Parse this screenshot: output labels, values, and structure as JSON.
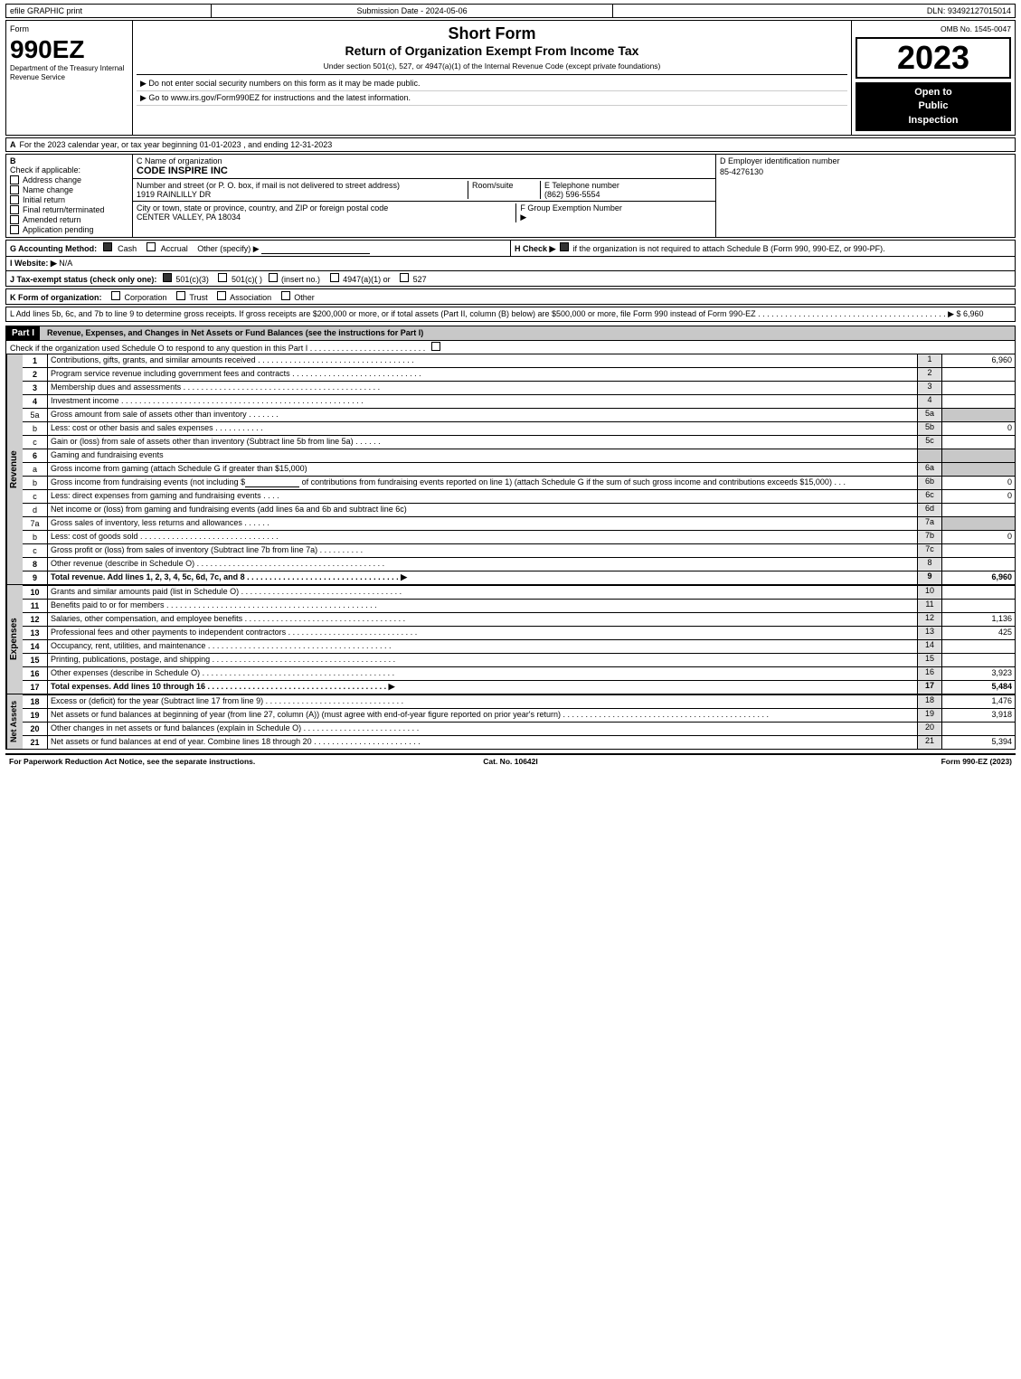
{
  "topBar": {
    "left": "efile GRAPHIC print",
    "mid": "Submission Date - 2024-05-06",
    "right": "DLN: 93492127015014"
  },
  "formNumber": "990EZ",
  "formDept": "Department of the Treasury Internal Revenue Service",
  "titles": {
    "main": "Short Form",
    "sub": "Return of Organization Exempt From Income Tax",
    "under": "Under section 501(c), 527, or 4947(a)(1) of the Internal Revenue Code (except private foundations)"
  },
  "notices": {
    "social": "▶ Do not enter social security numbers on this form as it may be made public.",
    "goto": "▶ Go to www.irs.gov/Form990EZ for instructions and the latest information."
  },
  "omb": "OMB No. 1545-0047",
  "year": "2023",
  "openToPublic": "Open to\nPublic\nInspection",
  "sectionA": {
    "label": "A",
    "text": "For the 2023 calendar year, or tax year beginning 01-01-2023 , and ending 12-31-2023"
  },
  "sectionB": {
    "label": "B",
    "checkLabel": "Check if applicable:",
    "checks": [
      {
        "label": "Address change",
        "checked": false
      },
      {
        "label": "Name change",
        "checked": false
      },
      {
        "label": "Initial return",
        "checked": false
      },
      {
        "label": "Final return/terminated",
        "checked": false
      },
      {
        "label": "Amended return",
        "checked": false
      },
      {
        "label": "Application pending",
        "checked": false
      }
    ]
  },
  "orgName": {
    "label": "C Name of organization",
    "value": "CODE INSPIRE INC"
  },
  "employerId": {
    "label": "D Employer identification number",
    "value": "85-4276130"
  },
  "address": {
    "label": "Number and street (or P. O. box, if mail is not delivered to street address)",
    "value": "1919 RAINLILLY DR",
    "roomLabel": "Room/suite",
    "roomValue": "",
    "eLabel": "E Telephone number",
    "eValue": "(862) 596-5554"
  },
  "cityState": {
    "label": "City or town, state or province, country, and ZIP or foreign postal code",
    "value": "CENTER VALLEY, PA  18034",
    "fLabel": "F Group Exemption Number",
    "fArrow": "▶"
  },
  "accounting": {
    "label": "G Accounting Method:",
    "cashChecked": true,
    "accrualChecked": false,
    "otherText": "Other (specify) ▶"
  },
  "hCheck": {
    "label": "H Check ▶",
    "checked": true,
    "text": "if the organization is not required to attach Schedule B (Form 990, 990-EZ, or 990-PF)."
  },
  "website": {
    "label": "I Website: ▶",
    "value": "N/A"
  },
  "taxExempt": {
    "label": "J Tax-exempt status (check only one):",
    "options": [
      {
        "label": "501(c)(3)",
        "checked": true
      },
      {
        "label": "501(c)(  )",
        "checked": false
      },
      {
        "label": "(insert no.)",
        "checked": false
      },
      {
        "label": "4947(a)(1) or",
        "checked": false
      },
      {
        "label": "527",
        "checked": false
      }
    ]
  },
  "formOrg": {
    "label": "K Form of organization:",
    "options": [
      {
        "label": "Corporation",
        "checked": false
      },
      {
        "label": "Trust",
        "checked": false
      },
      {
        "label": "Association",
        "checked": false
      },
      {
        "label": "Other",
        "checked": false
      }
    ]
  },
  "lineL": {
    "text": "L Add lines 5b, 6c, and 7b to line 9 to determine gross receipts. If gross receipts are $200,000 or more, or if total assets (Part II, column (B) below) are $500,000 or more, file Form 990 instead of Form 990-EZ . . . . . . . . . . . . . . . . . . . . . . . . . . . . . . . . . . . . . . . . . . ▶ $ 6,960"
  },
  "partI": {
    "label": "Part I",
    "title": "Revenue, Expenses, and Changes in Net Assets or Fund Balances (see the instructions for Part I)",
    "scheduleO": "Check if the organization used Schedule O to respond to any question in this Part I . . . . . . . . . . . . . . . . . . . . . . . . . .",
    "rows": [
      {
        "num": "1",
        "desc": "Contributions, gifts, grants, and similar amounts received",
        "lineNum": "1",
        "amount": "6,960",
        "dots": true
      },
      {
        "num": "2",
        "desc": "Program service revenue including government fees and contracts",
        "lineNum": "2",
        "amount": "",
        "dots": true
      },
      {
        "num": "3",
        "desc": "Membership dues and assessments",
        "lineNum": "3",
        "amount": "",
        "dots": true
      },
      {
        "num": "4",
        "desc": "Investment income",
        "lineNum": "4",
        "amount": "",
        "dots": true
      },
      {
        "num": "5a",
        "desc": "Gross amount from sale of assets other than inventory . . . . . . .",
        "lineNum": "5a",
        "amount": "",
        "subLine": true
      },
      {
        "num": "b",
        "desc": "Less: cost or other basis and sales expenses . . . . . . . . . . .",
        "lineNum": "5b",
        "amount": "0",
        "subLine": true
      },
      {
        "num": "c",
        "desc": "Gain or (loss) from sale of assets other than inventory (Subtract line 5b from line 5a) . . . . . .",
        "lineNum": "5c",
        "amount": "",
        "dots": false
      },
      {
        "num": "6",
        "desc": "Gaming and fundraising events",
        "lineNum": "",
        "amount": "",
        "header": true
      },
      {
        "num": "a",
        "desc": "Gross income from gaming (attach Schedule G if greater than $15,000)",
        "lineNum": "6a",
        "amount": "",
        "subLine": true
      },
      {
        "num": "b",
        "desc": "Gross income from fundraising events (not including $_____ of contributions from fundraising events reported on line 1) (attach Schedule G if the sum of such gross income and contributions exceeds $15,000) . . .",
        "lineNum": "6b",
        "amount": "0",
        "subLine": true,
        "multiline": true
      },
      {
        "num": "c",
        "desc": "Less: direct expenses from gaming and fundraising events . . . .",
        "lineNum": "6c",
        "amount": "0",
        "subLine": true
      },
      {
        "num": "d",
        "desc": "Net income or (loss) from gaming and fundraising events (add lines 6a and 6b and subtract line 6c)",
        "lineNum": "6d",
        "amount": "",
        "dots": false
      },
      {
        "num": "7a",
        "desc": "Gross sales of inventory, less returns and allowances . . . . . .",
        "lineNum": "7a",
        "amount": "",
        "subLine": true
      },
      {
        "num": "b",
        "desc": "Less: cost of goods sold . . . . . . . . . . . . . . . . . . .",
        "lineNum": "7b",
        "amount": "0",
        "subLine": true
      },
      {
        "num": "c",
        "desc": "Gross profit or (loss) from sales of inventory (Subtract line 7b from line 7a) . . . . . . . . . .",
        "lineNum": "7c",
        "amount": "",
        "dots": false
      },
      {
        "num": "8",
        "desc": "Other revenue (describe in Schedule O) . . . . . . . . . . . . . . . . . . . . . . . . . . . . .",
        "lineNum": "8",
        "amount": "",
        "dots": false
      },
      {
        "num": "9",
        "desc": "Total revenue. Add lines 1, 2, 3, 4, 5c, 6d, 7c, and 8 . . . . . . . . . . . . . . . . . . . . . . . . . ▶",
        "lineNum": "9",
        "amount": "6,960",
        "bold": true,
        "dots": false
      }
    ]
  },
  "expenses": {
    "rows": [
      {
        "num": "10",
        "desc": "Grants and similar amounts paid (list in Schedule O) . . . . . . . . . . . . . . . . . . . . . . . . . .",
        "lineNum": "10",
        "amount": ""
      },
      {
        "num": "11",
        "desc": "Benefits paid to or for members . . . . . . . . . . . . . . . . . . . . . . . . . . . . . . . . . . . .",
        "lineNum": "11",
        "amount": ""
      },
      {
        "num": "12",
        "desc": "Salaries, other compensation, and employee benefits . . . . . . . . . . . . . . . . . . . . . . . . . .",
        "lineNum": "12",
        "amount": "1,136"
      },
      {
        "num": "13",
        "desc": "Professional fees and other payments to independent contractors . . . . . . . . . . . . . . . . . . . .",
        "lineNum": "13",
        "amount": "425"
      },
      {
        "num": "14",
        "desc": "Occupancy, rent, utilities, and maintenance . . . . . . . . . . . . . . . . . . . . . . . . . . . . . . .",
        "lineNum": "14",
        "amount": ""
      },
      {
        "num": "15",
        "desc": "Printing, publications, postage, and shipping . . . . . . . . . . . . . . . . . . . . . . . . . . . . . . .",
        "lineNum": "15",
        "amount": ""
      },
      {
        "num": "16",
        "desc": "Other expenses (describe in Schedule O) . . . . . . . . . . . . . . . . . . . . . . . . . . . . . . . . .",
        "lineNum": "16",
        "amount": "3,923"
      },
      {
        "num": "17",
        "desc": "Total expenses. Add lines 10 through 16 . . . . . . . . . . . . . . . . . . . . . . . . . . . . . . . ▶",
        "lineNum": "17",
        "amount": "5,484",
        "bold": true
      }
    ]
  },
  "netAssets": {
    "rows": [
      {
        "num": "18",
        "desc": "Excess or (deficit) for the year (Subtract line 17 from line 9) . . . . . . . . . . . . . . . . . . . . . .",
        "lineNum": "18",
        "amount": "1,476"
      },
      {
        "num": "19",
        "desc": "Net assets or fund balances at beginning of year (from line 27, column (A)) (must agree with end-of-year figure reported on prior year's return) . . . . . . . . . . . . . . . . . . . . . . . . . . . .",
        "lineNum": "19",
        "amount": "3,918"
      },
      {
        "num": "20",
        "desc": "Other changes in net assets or fund balances (explain in Schedule O) . . . . . . . . . . . . . . . . .",
        "lineNum": "20",
        "amount": ""
      },
      {
        "num": "21",
        "desc": "Net assets or fund balances at end of year. Combine lines 18 through 20 . . . . . . . . . . . . . . .",
        "lineNum": "21",
        "amount": "5,394"
      }
    ]
  },
  "footer": {
    "left": "For Paperwork Reduction Act Notice, see the separate instructions.",
    "mid": "Cat. No. 10642I",
    "right": "Form 990-EZ (2023)"
  }
}
